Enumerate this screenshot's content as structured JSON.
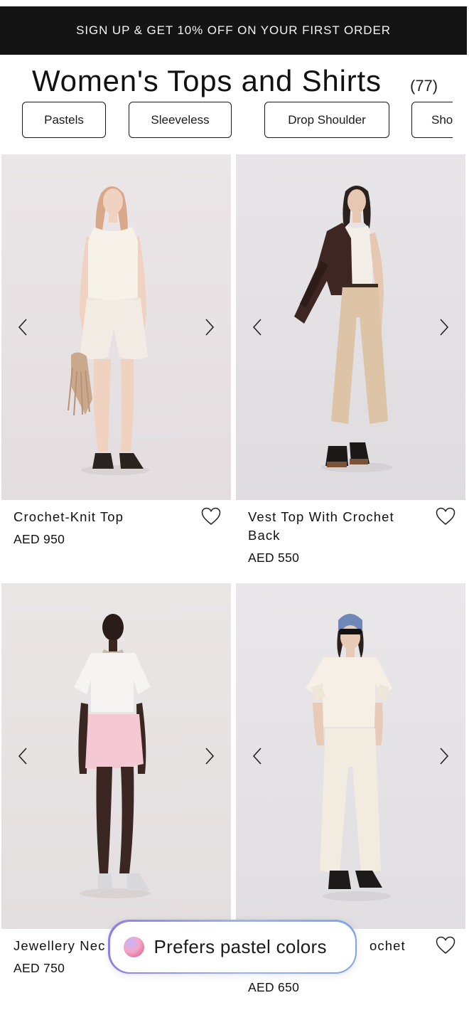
{
  "promo": {
    "text": "SIGN UP & GET 10% OFF ON YOUR FIRST ORDER"
  },
  "header": {
    "title": "Women's Tops and Shirts",
    "count": "(77)"
  },
  "filters": [
    {
      "label": "Pastels"
    },
    {
      "label": "Sleeveless"
    },
    {
      "label": "Drop Shoulder"
    },
    {
      "label": "Sho"
    }
  ],
  "products": [
    {
      "name": "Crochet-Knit Top",
      "price": "AED 950"
    },
    {
      "name": "Vest Top With Crochet Back",
      "price": "AED 550"
    },
    {
      "name": "Jewellery Nec",
      "price": "AED 750"
    },
    {
      "name": "ochet",
      "price": "AED 650"
    }
  ],
  "ai_suggestion": {
    "text": "Prefers pastel colors"
  },
  "icons": {
    "prev": "chevron-left-icon",
    "next": "chevron-right-icon",
    "wishlist": "heart-outline-icon"
  },
  "colors": {
    "promo_bg": "#141414",
    "photo_bg": "#e9e5e6",
    "toast_border_start": "#8f7ee8",
    "toast_border_end": "#7fa3ec"
  }
}
